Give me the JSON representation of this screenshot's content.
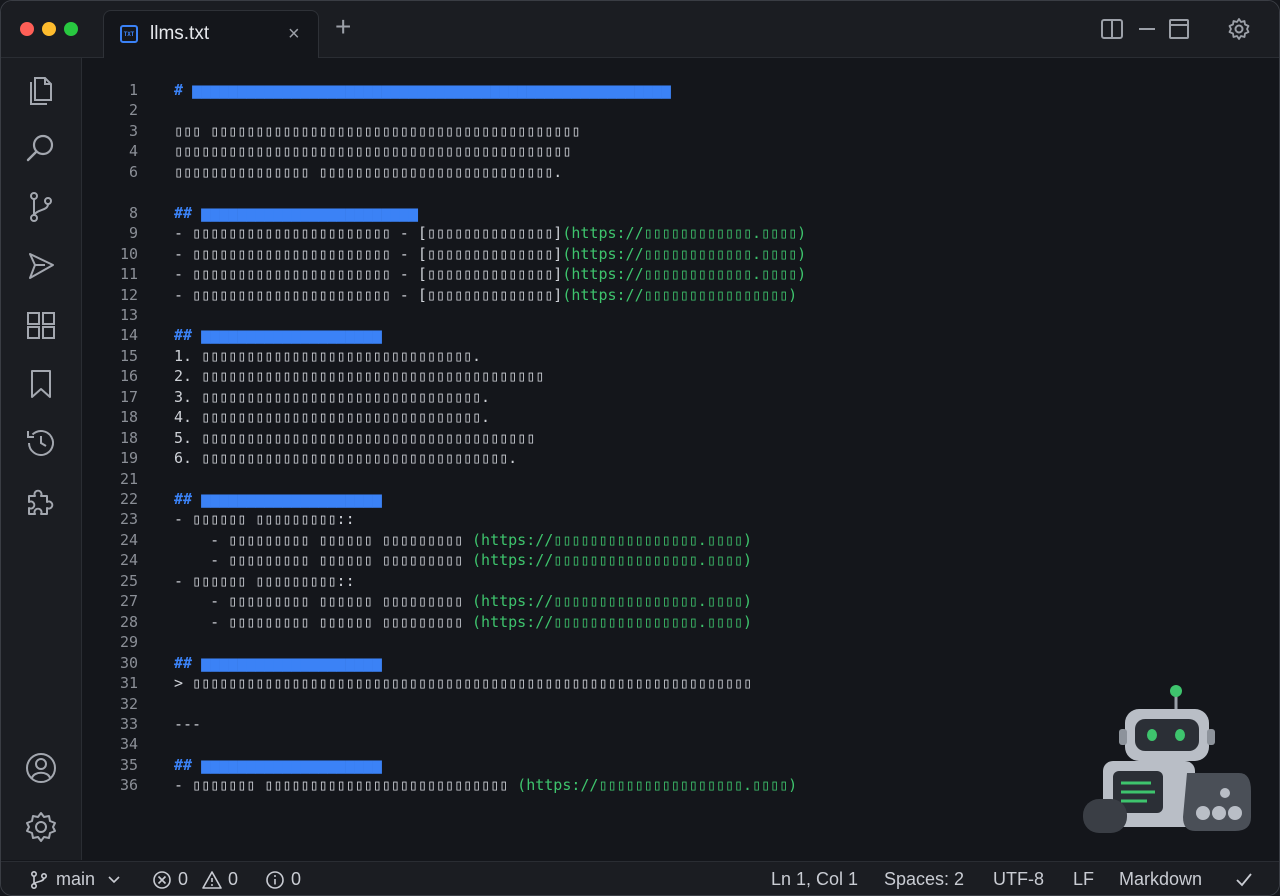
{
  "window": {
    "tab": {
      "title": "llms.txt",
      "icon": "file-code-icon",
      "close": "×"
    },
    "new_tab": "+",
    "controls": [
      "split-editor-icon",
      "minimize-icon",
      "maximize-icon",
      "settings-gear-icon"
    ]
  },
  "activity_bar": {
    "top": [
      "files-icon",
      "search-icon",
      "source-control-icon",
      "run-debug-icon",
      "extensions-icon",
      "bookmark-icon",
      "history-icon",
      "puzzle-icon"
    ],
    "bottom": [
      "account-icon",
      "settings-icon"
    ]
  },
  "editor": {
    "lines": [
      {
        "n": "1",
        "parts": [
          {
            "t": "# ",
            "c": "hd"
          },
          {
            "t": "▆▆▆▆▆▆▆▆▆▆▆▆▆▆▆▆▆▆▆▆▆▆▆▆▆▆▆▆▆▆▆▆▆▆▆▆▆▆▆▆▆▆▆▆▆▆▆▆▆▆▆▆▆",
            "c": "hd"
          }
        ]
      },
      {
        "n": "2",
        "parts": []
      },
      {
        "n": "3",
        "parts": [
          {
            "t": "▯▯▯ ▯▯▯▯▯▯▯▯▯▯▯▯▯▯▯▯▯▯▯▯▯▯▯▯▯▯▯▯▯▯▯▯▯▯▯▯▯▯▯▯▯"
          }
        ]
      },
      {
        "n": "4",
        "parts": [
          {
            "t": "▯▯▯▯▯▯▯▯▯▯▯▯▯▯▯▯▯▯▯▯▯▯▯▯▯▯▯▯▯▯▯▯▯▯▯▯▯▯▯▯▯▯▯▯"
          }
        ]
      },
      {
        "n": "6",
        "parts": [
          {
            "t": "▯▯▯▯▯▯▯▯▯▯▯▯▯▯▯ ▯▯▯▯▯▯▯▯▯▯▯▯▯▯▯▯▯▯▯▯▯▯▯▯▯▯."
          }
        ]
      },
      {
        "n": "",
        "parts": []
      },
      {
        "n": "8",
        "parts": [
          {
            "t": "## ",
            "c": "hd"
          },
          {
            "t": "▆▆▆▆▆▆▆▆▆▆▆▆▆▆▆▆▆▆▆▆▆▆▆▆",
            "c": "hd"
          }
        ]
      },
      {
        "n": "9",
        "parts": [
          {
            "t": "- ▯▯▯▯▯▯▯▯▯▯▯▯▯▯▯▯▯▯▯▯▯▯ - [▯▯▯▯▯▯▯▯▯▯▯▯▯▯]"
          },
          {
            "t": "(https://▯▯▯▯▯▯▯▯▯▯▯▯.▯▯▯▯)",
            "c": "lk"
          }
        ]
      },
      {
        "n": "10",
        "parts": [
          {
            "t": "- ▯▯▯▯▯▯▯▯▯▯▯▯▯▯▯▯▯▯▯▯▯▯ - [▯▯▯▯▯▯▯▯▯▯▯▯▯▯]"
          },
          {
            "t": "(https://▯▯▯▯▯▯▯▯▯▯▯▯.▯▯▯▯)",
            "c": "lk"
          }
        ]
      },
      {
        "n": "11",
        "parts": [
          {
            "t": "- ▯▯▯▯▯▯▯▯▯▯▯▯▯▯▯▯▯▯▯▯▯▯ - [▯▯▯▯▯▯▯▯▯▯▯▯▯▯]"
          },
          {
            "t": "(https://▯▯▯▯▯▯▯▯▯▯▯▯.▯▯▯▯)",
            "c": "lk"
          }
        ]
      },
      {
        "n": "12",
        "parts": [
          {
            "t": "- ▯▯▯▯▯▯▯▯▯▯▯▯▯▯▯▯▯▯▯▯▯▯ - [▯▯▯▯▯▯▯▯▯▯▯▯▯▯]"
          },
          {
            "t": "(https://▯▯▯▯▯▯▯▯▯▯▯▯▯▯▯▯)",
            "c": "lk"
          }
        ]
      },
      {
        "n": "13",
        "parts": []
      },
      {
        "n": "14",
        "parts": [
          {
            "t": "## ",
            "c": "hd"
          },
          {
            "t": "▆▆▆▆▆▆▆▆▆▆▆▆▆▆▆▆▆▆▆▆",
            "c": "hd"
          }
        ]
      },
      {
        "n": "15",
        "parts": [
          {
            "t": "1. ▯▯▯▯▯▯▯▯▯▯▯▯▯▯▯▯▯▯▯▯▯▯▯▯▯▯▯▯▯▯."
          }
        ]
      },
      {
        "n": "16",
        "parts": [
          {
            "t": "2. ▯▯▯▯▯▯▯▯▯▯▯▯▯▯▯▯▯▯▯▯▯▯▯▯▯▯▯▯▯▯▯▯▯▯▯▯▯▯"
          }
        ]
      },
      {
        "n": "17",
        "parts": [
          {
            "t": "3. ▯▯▯▯▯▯▯▯▯▯▯▯▯▯▯▯▯▯▯▯▯▯▯▯▯▯▯▯▯▯▯."
          }
        ]
      },
      {
        "n": "18",
        "parts": [
          {
            "t": "4. ▯▯▯▯▯▯▯▯▯▯▯▯▯▯▯▯▯▯▯▯▯▯▯▯▯▯▯▯▯▯▯."
          }
        ]
      },
      {
        "n": "18",
        "parts": [
          {
            "t": "5. ▯▯▯▯▯▯▯▯▯▯▯▯▯▯▯▯▯▯▯▯▯▯▯▯▯▯▯▯▯▯▯▯▯▯▯▯▯"
          }
        ]
      },
      {
        "n": "19",
        "parts": [
          {
            "t": "6. ▯▯▯▯▯▯▯▯▯▯▯▯▯▯▯▯▯▯▯▯▯▯▯▯▯▯▯▯▯▯▯▯▯▯."
          }
        ]
      },
      {
        "n": "21",
        "parts": []
      },
      {
        "n": "22",
        "parts": [
          {
            "t": "## ",
            "c": "hd"
          },
          {
            "t": "▆▆▆▆▆▆▆▆▆▆▆▆▆▆▆▆▆▆▆▆",
            "c": "hd"
          }
        ]
      },
      {
        "n": "23",
        "parts": [
          {
            "t": "- ▯▯▯▯▯▯ ▯▯▯▯▯▯▯▯▯::"
          }
        ]
      },
      {
        "n": "24",
        "parts": [
          {
            "t": "    - ▯▯▯▯▯▯▯▯▯ ▯▯▯▯▯▯ ▯▯▯▯▯▯▯▯▯ "
          },
          {
            "t": "(https://▯▯▯▯▯▯▯▯▯▯▯▯▯▯▯▯.▯▯▯▯)",
            "c": "lk"
          }
        ]
      },
      {
        "n": "24",
        "parts": [
          {
            "t": "    - ▯▯▯▯▯▯▯▯▯ ▯▯▯▯▯▯ ▯▯▯▯▯▯▯▯▯ "
          },
          {
            "t": "(https://▯▯▯▯▯▯▯▯▯▯▯▯▯▯▯▯.▯▯▯▯)",
            "c": "lk"
          }
        ]
      },
      {
        "n": "25",
        "parts": [
          {
            "t": "- ▯▯▯▯▯▯ ▯▯▯▯▯▯▯▯▯::"
          }
        ]
      },
      {
        "n": "27",
        "parts": [
          {
            "t": "    - ▯▯▯▯▯▯▯▯▯ ▯▯▯▯▯▯ ▯▯▯▯▯▯▯▯▯ "
          },
          {
            "t": "(https://▯▯▯▯▯▯▯▯▯▯▯▯▯▯▯▯.▯▯▯▯)",
            "c": "lk"
          }
        ]
      },
      {
        "n": "28",
        "parts": [
          {
            "t": "    - ▯▯▯▯▯▯▯▯▯ ▯▯▯▯▯▯ ▯▯▯▯▯▯▯▯▯ "
          },
          {
            "t": "(https://▯▯▯▯▯▯▯▯▯▯▯▯▯▯▯▯.▯▯▯▯)",
            "c": "lk"
          }
        ]
      },
      {
        "n": "29",
        "parts": []
      },
      {
        "n": "30",
        "parts": [
          {
            "t": "## ",
            "c": "hd"
          },
          {
            "t": "▆▆▆▆▆▆▆▆▆▆▆▆▆▆▆▆▆▆▆▆",
            "c": "hd"
          }
        ]
      },
      {
        "n": "31",
        "parts": [
          {
            "t": "> ▯▯▯▯▯▯▯▯▯▯▯▯▯▯▯▯▯▯▯▯▯▯▯▯▯▯▯▯▯▯▯▯▯▯▯▯▯▯▯▯▯▯▯▯▯▯▯▯▯▯▯▯▯▯▯▯▯▯▯▯▯▯"
          }
        ]
      },
      {
        "n": "32",
        "parts": []
      },
      {
        "n": "33",
        "parts": [
          {
            "t": "---"
          }
        ]
      },
      {
        "n": "34",
        "parts": []
      },
      {
        "n": "35",
        "parts": [
          {
            "t": "## ",
            "c": "hd"
          },
          {
            "t": "▆▆▆▆▆▆▆▆▆▆▆▆▆▆▆▆▆▆▆▆",
            "c": "hd"
          }
        ]
      },
      {
        "n": "36",
        "parts": [
          {
            "t": "- ▯▯▯▯▯▯▯ ▯▯▯▯▯▯▯▯▯▯▯▯▯▯▯▯▯▯▯▯▯▯▯▯▯▯▯ "
          },
          {
            "t": "(https://▯▯▯▯▯▯▯▯▯▯▯▯▯▯▯▯.▯▯▯▯)",
            "c": "lk"
          }
        ]
      }
    ]
  },
  "status_bar": {
    "branch": "main",
    "errors": "0",
    "warnings": "0",
    "info": "0",
    "position": "Ln 1, Col 1",
    "spaces": "Spaces: 2",
    "encoding": "UTF-8",
    "eol": "LF",
    "language": "Markdown"
  },
  "colors": {
    "heading": "#3b82f6",
    "link": "#3ec46d",
    "background": "#14161b"
  }
}
